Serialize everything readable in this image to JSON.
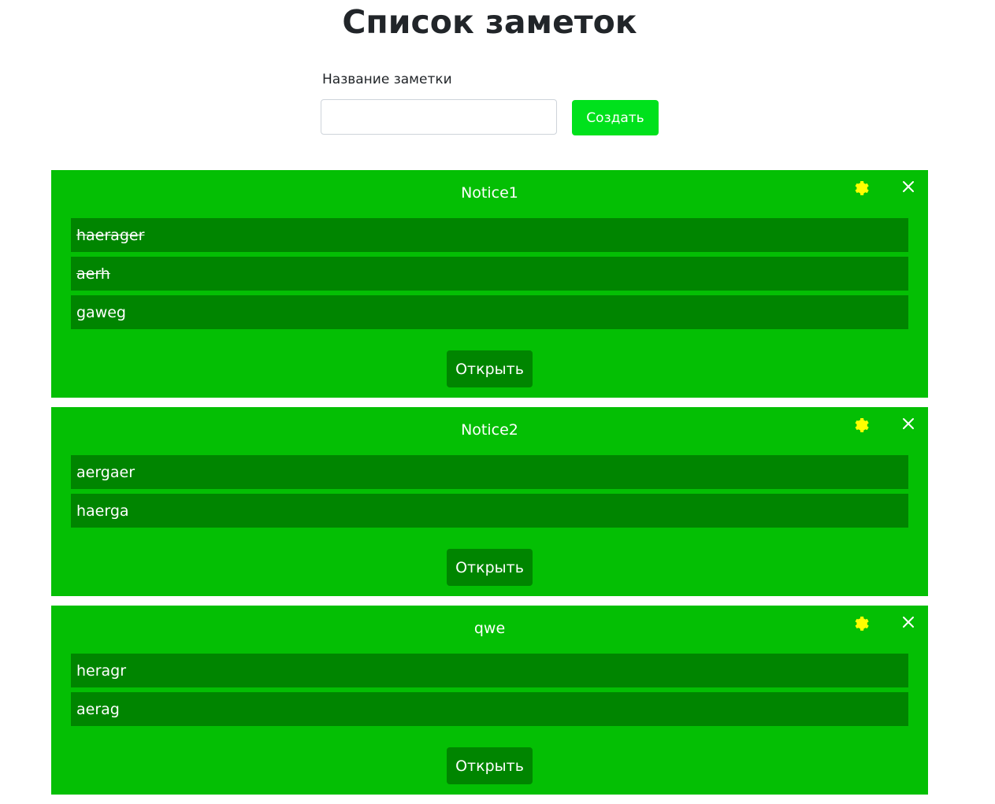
{
  "header": {
    "title": "Список заметок"
  },
  "form": {
    "label": "Название заметки",
    "input_value": "",
    "input_placeholder": "",
    "create_label": "Создать"
  },
  "colors": {
    "card_bg": "#04bf04",
    "item_bg": "#008500",
    "create_button": "#00e11c",
    "gear_icon": "#ffff00"
  },
  "icons": {
    "settings": "gear-icon",
    "delete": "close-icon"
  },
  "notes": [
    {
      "title": "Notice1",
      "items": [
        {
          "text": "haerager",
          "done": true
        },
        {
          "text": "aerh",
          "done": true
        },
        {
          "text": "gaweg",
          "done": false
        }
      ],
      "open_label": "Открыть"
    },
    {
      "title": "Notice2",
      "items": [
        {
          "text": "aergaer",
          "done": false
        },
        {
          "text": "haerga",
          "done": false
        }
      ],
      "open_label": "Открыть"
    },
    {
      "title": "qwe",
      "items": [
        {
          "text": "heragr",
          "done": false
        },
        {
          "text": "aerag",
          "done": false
        }
      ],
      "open_label": "Открыть"
    }
  ]
}
